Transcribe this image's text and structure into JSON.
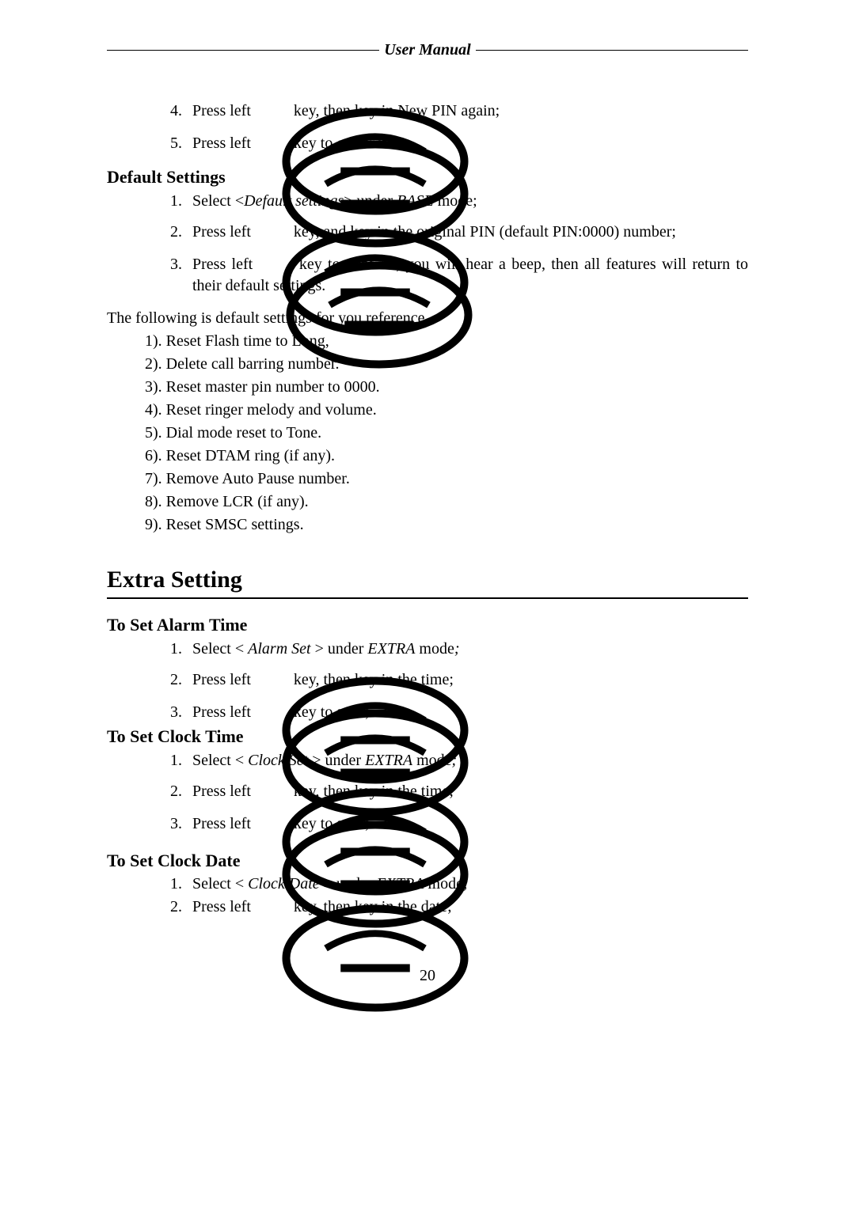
{
  "header": {
    "title": "User Manual"
  },
  "top_steps": [
    {
      "n": "4.",
      "pre": "Press left ",
      "post": " key, then key in New PIN again;"
    },
    {
      "n": "5.",
      "pre": "Press left ",
      "post": "key to confirm."
    }
  ],
  "default_settings": {
    "heading": "Default Settings",
    "steps": [
      {
        "n": "1.",
        "text_pre": "Select <",
        "term": "Default settings",
        "text_mid": "> under ",
        "term2": "BASE",
        "text_post": " mode;"
      },
      {
        "n": "2.",
        "pre": "Press left ",
        "post": "key, and key in the original PIN (default PIN:0000) number;"
      },
      {
        "n": "3.",
        "pre": "Press left ",
        "post": "key to confirm, you will hear a beep, then all features will return to their default settings."
      }
    ],
    "intro": "The following is default settings for you reference.",
    "items": [
      "1). Reset Flash time to Long,",
      "2). Delete call barring number.",
      "3). Reset master pin number to 0000.",
      "4). Reset ringer melody and volume.",
      "5). Dial mode reset to Tone.",
      "6). Reset DTAM ring (if any).",
      "7). Remove Auto Pause number.",
      "8). Remove LCR (if any).",
      "9). Reset SMSC settings."
    ]
  },
  "extra": {
    "chapter": "Extra Setting",
    "alarm": {
      "heading": "To Set Alarm Time",
      "steps": [
        {
          "n": "1.",
          "text_pre": "Select < ",
          "term": "Alarm Set",
          "text_mid": " > under ",
          "term2": "EXTRA",
          "text_post": " mode",
          "term3": ";"
        },
        {
          "n": "2.",
          "pre": "Press left ",
          "post": "key, then key in the time;"
        },
        {
          "n": "3.",
          "pre": "Press left ",
          "post": "key to save;"
        }
      ]
    },
    "clock_time": {
      "heading": "To Set Clock Time",
      "steps": [
        {
          "n": "1.",
          "text_pre": "Select < ",
          "term": "Clock Set",
          "text_mid": " > under ",
          "term2": "EXTRA",
          "text_post": " mode",
          "term3": ";"
        },
        {
          "n": "2.",
          "pre": "Press left ",
          "post": "key, then key in the time;"
        },
        {
          "n": "3.",
          "pre": "Press left ",
          "post": "key to save;"
        }
      ]
    },
    "clock_date": {
      "heading": "To Set Clock Date",
      "steps": [
        {
          "n": "1.",
          "text_pre": "Select < ",
          "term": "Clock Date",
          "text_mid": " > under ",
          "term2": "EXTRA",
          "text_post": " mode",
          "term3": ";"
        },
        {
          "n": "2.",
          "pre": "Press left ",
          "post": "key, then key in the date;"
        }
      ]
    }
  },
  "page_number": "20"
}
